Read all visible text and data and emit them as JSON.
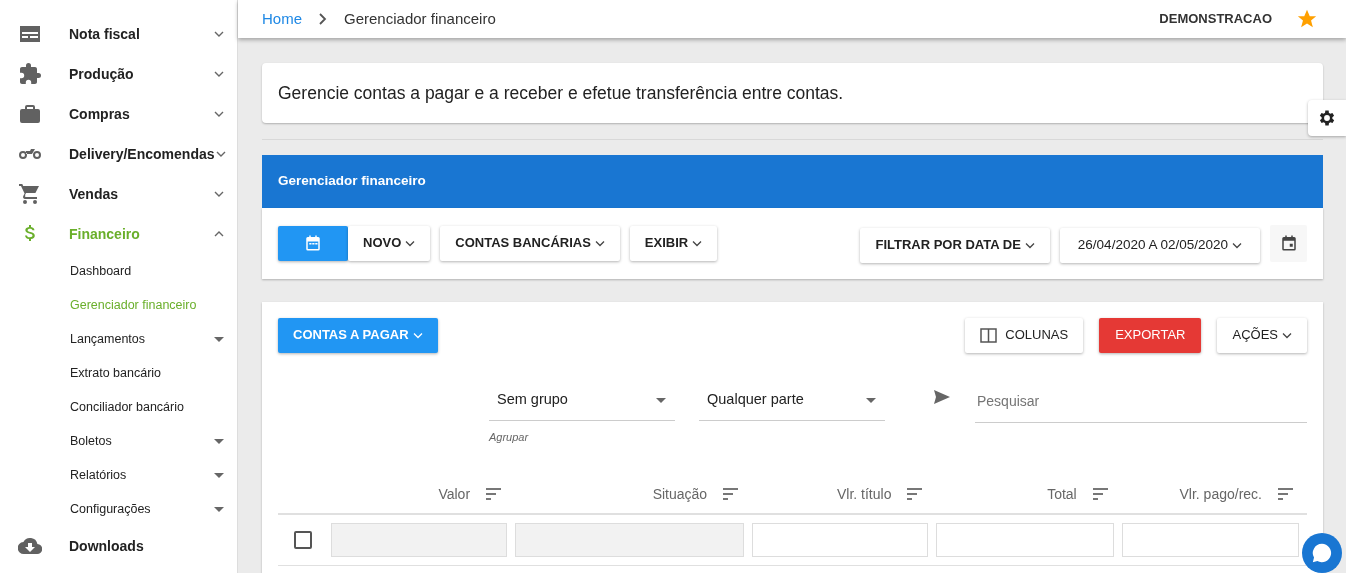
{
  "sidebar": {
    "items": [
      {
        "label": "Nota fiscal",
        "expanded": false,
        "selected": false
      },
      {
        "label": "Produção",
        "expanded": false,
        "selected": false
      },
      {
        "label": "Compras",
        "expanded": false,
        "selected": false
      },
      {
        "label": "Delivery/Encomendas",
        "expanded": false,
        "selected": false
      },
      {
        "label": "Vendas",
        "expanded": false,
        "selected": false
      },
      {
        "label": "Financeiro",
        "expanded": true,
        "selected": true,
        "children": [
          {
            "label": "Dashboard",
            "kind": "link",
            "selected": false
          },
          {
            "label": "Gerenciador financeiro",
            "kind": "link",
            "selected": true
          },
          {
            "label": "Lançamentos",
            "kind": "submenu",
            "selected": false
          },
          {
            "label": "Extrato bancário",
            "kind": "link",
            "selected": false
          },
          {
            "label": "Conciliador bancário",
            "kind": "link",
            "selected": false
          },
          {
            "label": "Boletos",
            "kind": "submenu",
            "selected": false
          },
          {
            "label": "Relatórios",
            "kind": "submenu",
            "selected": false
          },
          {
            "label": "Configurações",
            "kind": "submenu",
            "selected": false
          }
        ]
      },
      {
        "label": "Downloads",
        "selected": false
      }
    ]
  },
  "breadcrumb": {
    "home": "Home",
    "current": "Gerenciador financeiro"
  },
  "user": "DEMONSTRACAO",
  "description": "Gerencie contas a pagar e a receber e efetue transferência entre contas.",
  "panel": {
    "title": "Gerenciador financeiro",
    "left_buttons": [
      "NOVO",
      "CONTAS BANCÁRIAS",
      "EXIBIR"
    ],
    "filter_button": "FILTRAR POR DATA DE",
    "date_range": "26/04/2020 A 02/05/2020"
  },
  "list": {
    "type_button": "CONTAS A PAGAR",
    "columns_button": "COLUNAS",
    "export_button": "EXPORTAR",
    "actions_button": "AÇÕES",
    "group_select": {
      "value": "Sem grupo",
      "label": "Agrupar"
    },
    "party_select": {
      "value": "Qualquer parte"
    },
    "search": {
      "placeholder": "Pesquisar"
    },
    "columns": [
      {
        "label": "Valor",
        "filter_disabled": true
      },
      {
        "label": "Situação",
        "filter_disabled": true
      },
      {
        "label": "Vlr. título",
        "filter_disabled": false
      },
      {
        "label": "Total",
        "filter_disabled": false
      },
      {
        "label": "Vlr. pago/rec.",
        "filter_disabled": false
      }
    ],
    "select_all_checked": false
  }
}
